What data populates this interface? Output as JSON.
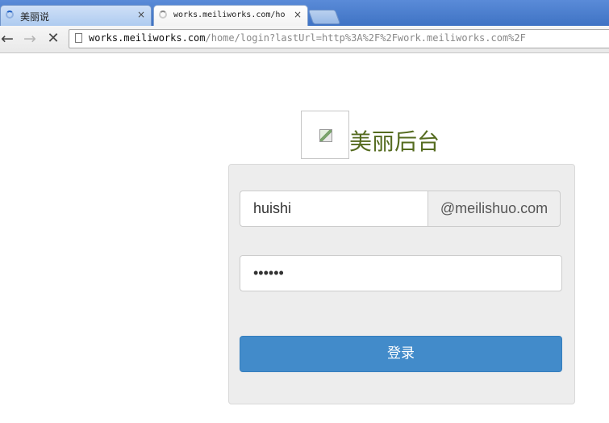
{
  "browser": {
    "tabs": [
      {
        "title": "美丽说",
        "close": "×"
      },
      {
        "title": "works.meiliworks.com/home/login",
        "close": "×"
      }
    ],
    "nav": {
      "back": "←",
      "forward": "→",
      "stop": "✕"
    },
    "url": {
      "host": "works.meiliworks.com",
      "path": "/home/login?lastUrl=http%3A%2F%2Fwork.meiliworks.com%2F"
    }
  },
  "page": {
    "title": "美丽后台",
    "login": {
      "username": "huishi",
      "domain_suffix": "@meilishuo.com",
      "password": "••••••",
      "submit_label": "登录"
    }
  },
  "colors": {
    "title": "#556b1f",
    "button": "#428bca",
    "panel": "#ededed"
  },
  "icons": [
    "loading-spinner-icon",
    "page-icon",
    "broken-image-icon"
  ]
}
